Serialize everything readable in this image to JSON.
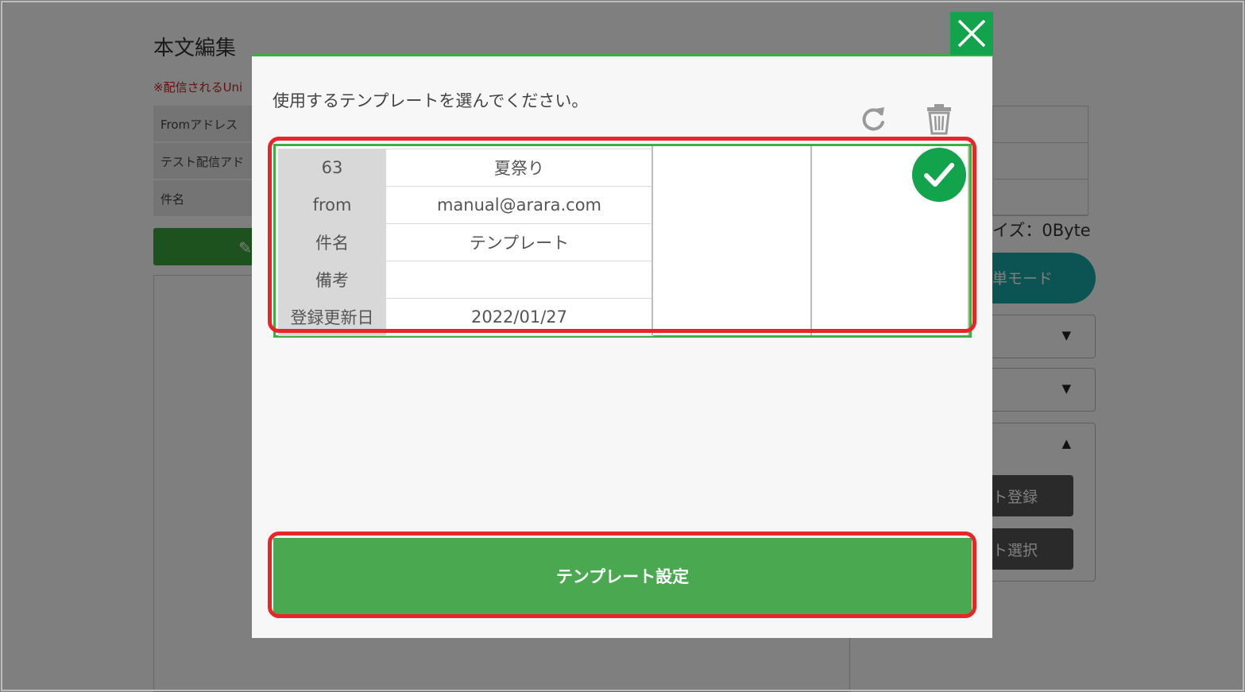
{
  "background": {
    "title": "本文編集",
    "note": "※配信されるUni",
    "fields": [
      "Fromアドレス",
      "テスト配信アド",
      "件名"
    ],
    "size_label": "イズ：0Byte",
    "mode_button": "単モード",
    "register_button": "ト登録",
    "select_button": "ト選択"
  },
  "modal": {
    "prompt": "使用するテンプレートを選んでください。",
    "template": {
      "rows": [
        {
          "key": "63",
          "value": "夏祭り"
        },
        {
          "key": "from",
          "value": "manual@arara.com"
        },
        {
          "key": "件名",
          "value": "テンプレート"
        },
        {
          "key": "備考",
          "value": ""
        },
        {
          "key": "登録更新日",
          "value": "2022/01/27"
        }
      ],
      "selected": true
    },
    "set_button": "テンプレート設定",
    "icons": {
      "close": "close-icon",
      "refresh": "refresh-icon",
      "trash": "trash-icon",
      "check": "check-icon"
    }
  },
  "colors": {
    "accent_green": "#3cb043",
    "button_green": "#4aa851",
    "badge_green": "#14a34d",
    "highlight_red": "#e8262a"
  }
}
